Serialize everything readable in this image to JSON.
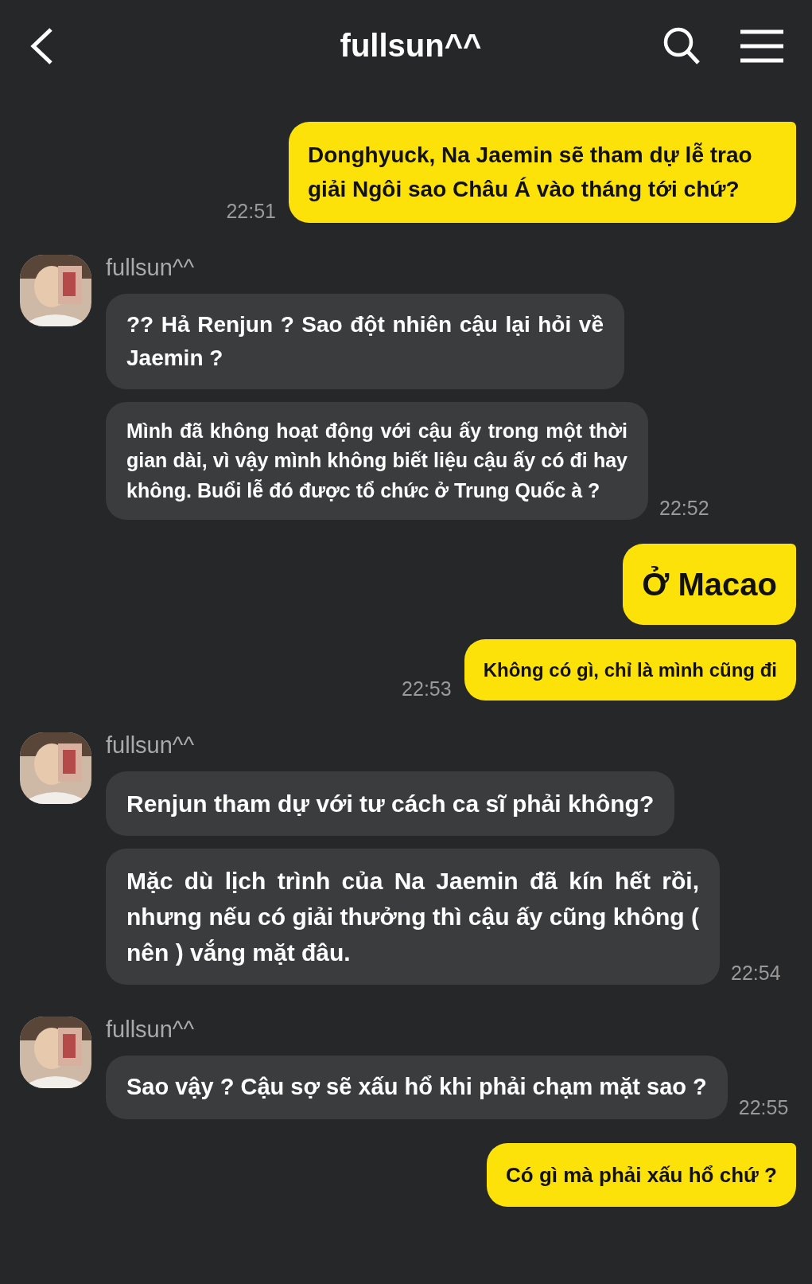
{
  "header": {
    "title": "fullsun^^"
  },
  "messages": [
    {
      "kind": "sent",
      "text": "Donghyuck, Na Jaemin sẽ tham dự lễ trao giải Ngôi sao Châu Á vào tháng tới chứ?",
      "time": "22:51"
    },
    {
      "kind": "received",
      "sender": "fullsun^^",
      "bubbles": [
        "?? Hả Renjun ? Sao đột nhiên cậu lại hỏi về Jaemin ?",
        "Mình đã không hoạt động với cậu ấy trong một thời gian dài, vì vậy mình không biết liệu cậu ấy có đi hay không. Buổi lễ đó được tổ chức ở Trung Quốc à ?"
      ],
      "time": "22:52"
    },
    {
      "kind": "sent",
      "text": "Ở Macao"
    },
    {
      "kind": "sent",
      "text": "Không có gì, chỉ là mình cũng đi",
      "time": "22:53"
    },
    {
      "kind": "received",
      "sender": "fullsun^^",
      "bubbles": [
        "Renjun tham dự với tư cách ca sĩ phải không?",
        "Mặc dù lịch trình của Na Jaemin đã kín hết rồi, nhưng nếu có giải thưởng thì cậu ấy cũng không ( nên ) vắng mặt đâu."
      ],
      "time": "22:54"
    },
    {
      "kind": "received",
      "sender": "fullsun^^",
      "bubbles": [
        "Sao vậy ? Cậu sợ sẽ xấu hổ khi phải chạm mặt sao ?"
      ],
      "time": "22:55"
    },
    {
      "kind": "sent",
      "text": "Có gì mà phải xấu hổ chứ ?"
    }
  ]
}
